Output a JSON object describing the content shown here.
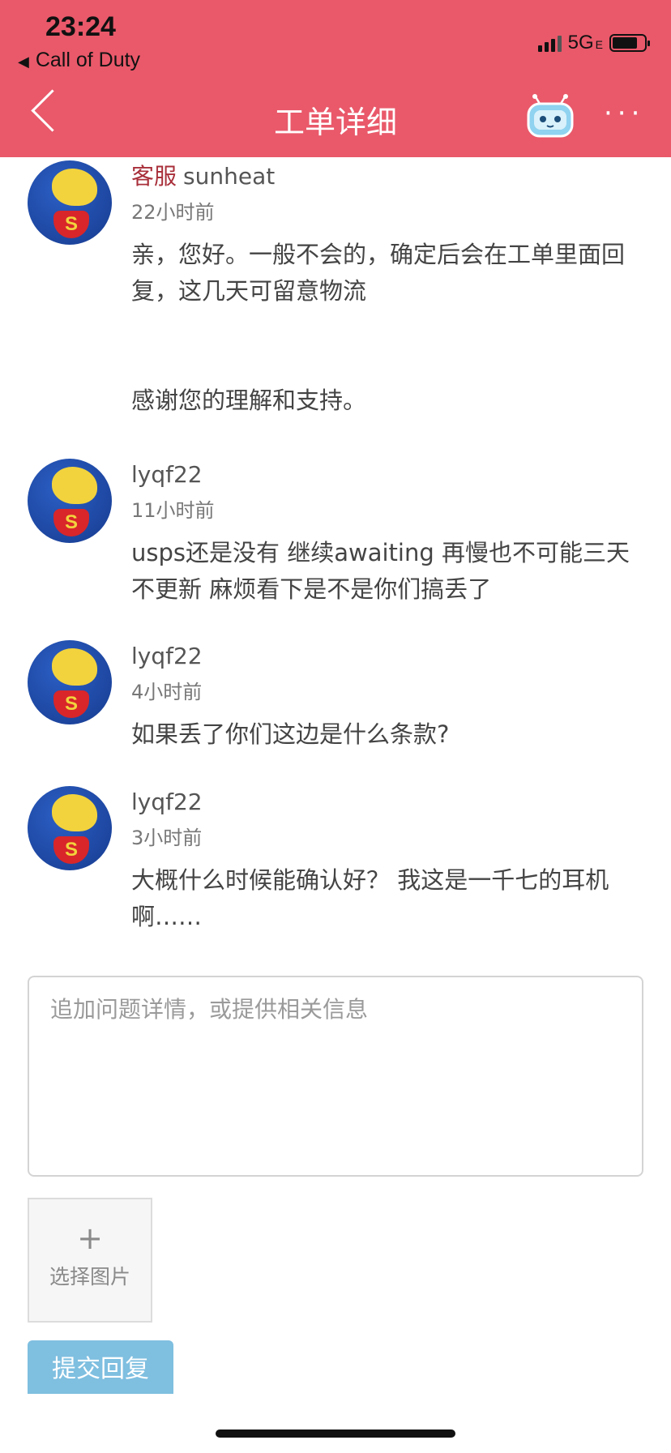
{
  "status_bar": {
    "time": "23:24",
    "back_app": "Call of Duty",
    "network": "5G",
    "network_suffix": "E"
  },
  "header": {
    "title": "工单详细"
  },
  "messages": [
    {
      "role": "客服",
      "author": "sunheat",
      "time": "22小时前",
      "text": "亲，您好。一般不会的，确定后会在工单里面回复，这几天可留意物流",
      "text2": "感谢您的理解和支持。"
    },
    {
      "author": "lyqf22",
      "time": "11小时前",
      "text": "usps还是没有 继续awaiting 再慢也不可能三天不更新 麻烦看下是不是你们搞丢了"
    },
    {
      "author": "lyqf22",
      "time": "4小时前",
      "text": "如果丢了你们这边是什么条款?"
    },
    {
      "author": "lyqf22",
      "time": "3小时前",
      "text": "大概什么时候能确认好？ 我这是一千七的耳机啊……"
    }
  ],
  "reply": {
    "placeholder": "追加问题详情，或提供相关信息",
    "add_image_icon": "+",
    "add_image_label": "选择图片",
    "submit_label": "提交回复"
  },
  "colors": {
    "header_bg": "#e9596a",
    "role_color": "#a82f3a",
    "submit_bg": "#7fbfe0"
  }
}
